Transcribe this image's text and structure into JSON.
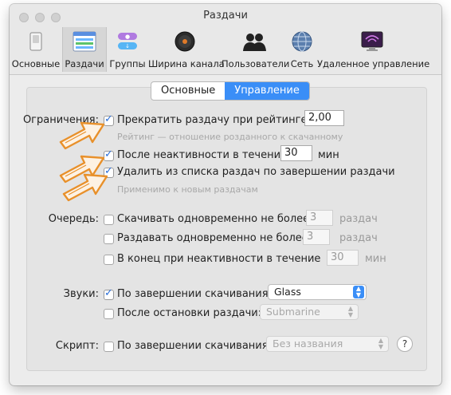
{
  "window": {
    "title": "Раздачи"
  },
  "toolbar": {
    "items": [
      {
        "label": "Основные",
        "icon": "switch-icon"
      },
      {
        "label": "Раздачи",
        "icon": "transfers-list-icon"
      },
      {
        "label": "Группы",
        "icon": "groups-icon"
      },
      {
        "label": "Ширина канала",
        "icon": "speed-dial-icon"
      },
      {
        "label": "Пользователи",
        "icon": "users-icon"
      },
      {
        "label": "Сеть",
        "icon": "globe-icon"
      },
      {
        "label": "Удаленное управление",
        "icon": "remote-display-icon"
      }
    ],
    "active": "Раздачи"
  },
  "tabs": {
    "basic": "Основные",
    "manage": "Управление",
    "active": "Управление"
  },
  "limits": {
    "label": "Ограничения:",
    "stop_ratio": {
      "label": "Прекратить раздачу при рейтинге:",
      "checked": true,
      "value": "2,00"
    },
    "ratio_hint": "Рейтинг — отношение розданного к скачанному",
    "idle": {
      "label": "После неактивности в течение",
      "checked": true,
      "value": "30",
      "unit": "мин"
    },
    "remove": {
      "label": "Удалить из списка раздач по завершении раздачи",
      "checked": true
    },
    "remove_hint": "Применимо к новым раздачам"
  },
  "queue": {
    "label": "Очередь:",
    "download": {
      "label": "Скачивать одновременно не более",
      "checked": false,
      "value": "3",
      "unit": "раздач"
    },
    "seed": {
      "label": "Раздавать одновременно не более",
      "checked": false,
      "value": "3",
      "unit": "раздач"
    },
    "stalled": {
      "label": "В конец при неактивности в течение",
      "checked": false,
      "value": "30",
      "unit": "мин"
    }
  },
  "sounds": {
    "label": "Звуки:",
    "download_done": {
      "label": "По завершении скачивания:",
      "checked": true,
      "selected": "Glass"
    },
    "seed_done": {
      "label": "После остановки раздачи:",
      "checked": false,
      "selected": "Submarine"
    }
  },
  "script": {
    "label": "Скрипт:",
    "on_done": {
      "label": "По завершении скачивания:",
      "checked": false,
      "selected": "Без названия"
    },
    "help": "?"
  },
  "colors": {
    "accent": "#3a8ef7",
    "arrow": "#e8902a"
  }
}
